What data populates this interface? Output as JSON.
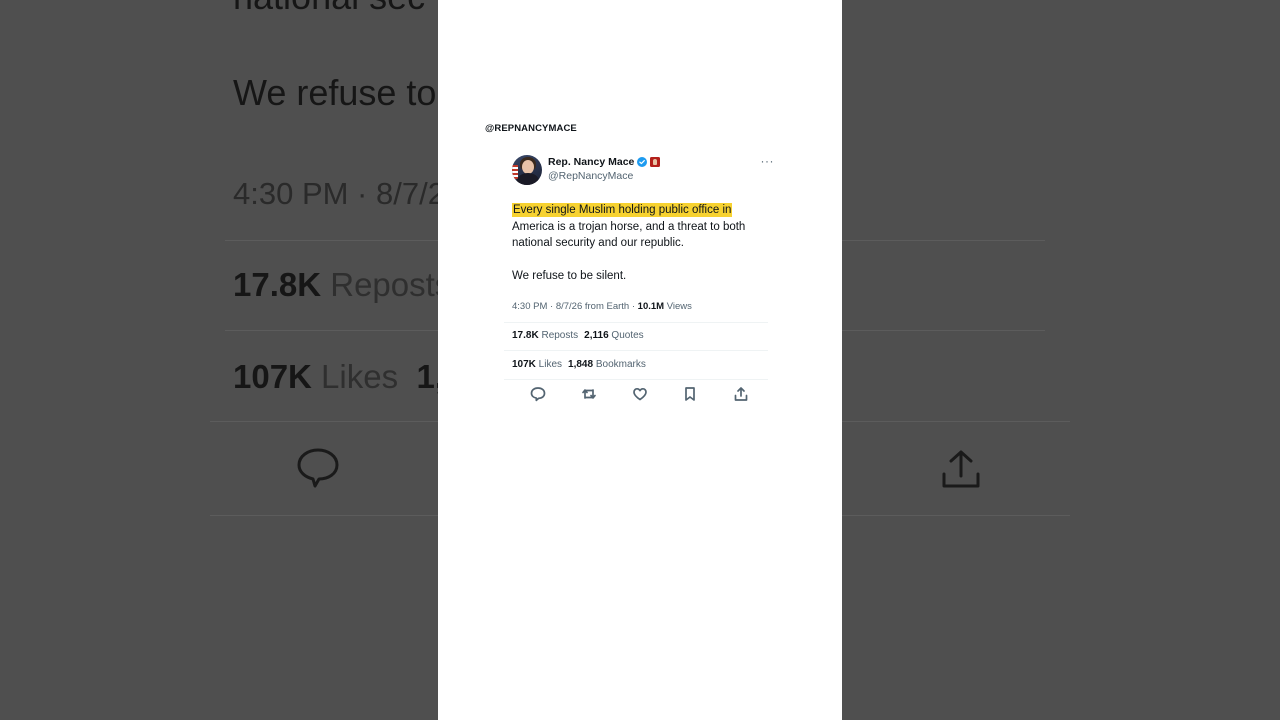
{
  "caption": {
    "handle": "@REPNANCYMACE"
  },
  "tweet": {
    "display_name": "Rep. Nancy Mace",
    "handle": "@RepNancyMace",
    "more": "···",
    "highlighted_text": "Every single Muslim holding public office in",
    "text_rest": "America is a trojan horse, and a threat to both national security and our republic.",
    "text_p2": "We refuse to be silent.",
    "timestamp": "4:30 PM · 8/7/26 from Earth · ",
    "views_count": "10.1M",
    "views_label": " Views",
    "reposts_count": "17.8K",
    "reposts_label": " Reposts",
    "quotes_count": "2,116",
    "quotes_label": " Quotes",
    "likes_count": "107K",
    "likes_label": " Likes",
    "bookmarks_count": "1,848",
    "bookmarks_label": " Bookmarks",
    "icons": [
      "reply-icon",
      "retweet-icon",
      "like-icon",
      "bookmark-icon",
      "share-icon"
    ]
  },
  "background": {
    "line1": "national sec",
    "line2": "We refuse to",
    "meta": "4:30 PM · 8/7/2",
    "reposts_count": "17.8K",
    "reposts_label": " Reposts",
    "likes_count": "107K",
    "likes_label": " Likes",
    "likes_tail": "1,"
  },
  "colors": {
    "highlight": "#f7d230",
    "verified": "#1d9bf0",
    "background": "#4f4f4f",
    "panel": "#ffffff"
  }
}
